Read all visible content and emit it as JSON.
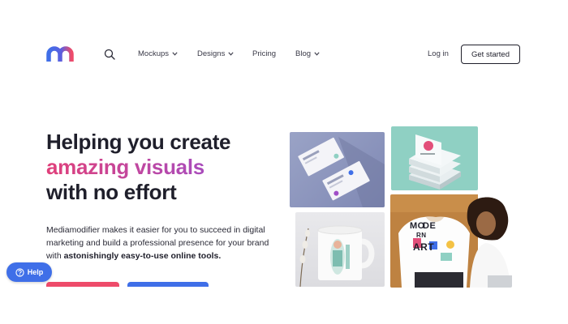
{
  "brand": {
    "accent_blue": "#3f6fe8",
    "accent_pink": "#ee4b6a",
    "accent_purple": "#a04ec7"
  },
  "nav": {
    "logo_icon": "mediamodifier-logo-icon",
    "search_icon": "search-icon",
    "items": [
      {
        "label": "Mockups",
        "has_dropdown": true
      },
      {
        "label": "Designs",
        "has_dropdown": true
      },
      {
        "label": "Pricing",
        "has_dropdown": false
      },
      {
        "label": "Blog",
        "has_dropdown": true
      }
    ],
    "login_label": "Log in",
    "get_started_label": "Get started"
  },
  "hero": {
    "line1": "Helping you create",
    "line2": "amazing visuals",
    "line3": "with no effort",
    "desc_part1": "Mediamodifier makes it easier for you to succeed in digital marketing and build a professional presence for your brand with ",
    "desc_bold": "astonishingly easy-to-use online tools."
  },
  "help": {
    "label": "Help",
    "icon": "question-circle-icon"
  },
  "images": {
    "person_shirt_text": [
      "MO",
      "DE",
      "RN",
      "ART"
    ]
  }
}
